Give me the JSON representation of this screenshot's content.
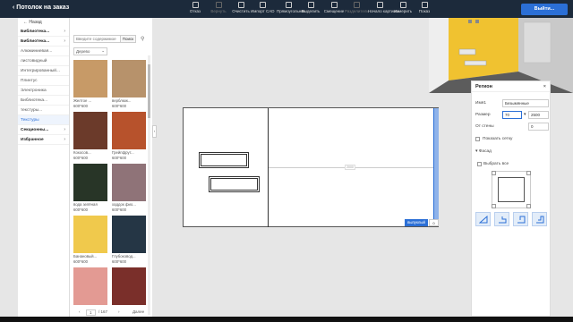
{
  "header": {
    "title": "Потолок на заказ",
    "tools": [
      {
        "label": "Отказ",
        "enabled": true
      },
      {
        "label": "Вернуть",
        "enabled": false
      },
      {
        "label": "Очистить",
        "enabled": true
      },
      {
        "label": "Импорт CAD",
        "enabled": true
      },
      {
        "label": "Прямоугольник",
        "enabled": true
      },
      {
        "label": "Выделить",
        "enabled": true
      },
      {
        "label": "Смещение",
        "enabled": true
      },
      {
        "label": "Разделитель",
        "enabled": false
      },
      {
        "label": "Начало картинки",
        "enabled": true
      },
      {
        "label": "Измерить",
        "enabled": true
      },
      {
        "label": "Показ",
        "enabled": true
      }
    ],
    "exit_label": "Выйти..."
  },
  "sidebar": {
    "back_label": "Назад",
    "items": [
      {
        "label": "Библиотека...",
        "bold": true,
        "chevron": "›"
      },
      {
        "label": "Библиотека...",
        "bold": true,
        "chevron": "›"
      },
      {
        "label": "Алюминиевая...",
        "bold": false,
        "chevron": ""
      },
      {
        "label": "листовидный",
        "bold": false,
        "chevron": ""
      },
      {
        "label": "Интегрированный...",
        "bold": false,
        "chevron": ""
      },
      {
        "label": "Плинтус",
        "bold": false,
        "chevron": ""
      },
      {
        "label": "Электроника",
        "bold": false,
        "chevron": ""
      },
      {
        "label": "Библиотека...",
        "bold": false,
        "chevron": ""
      },
      {
        "label": "текстуры...",
        "bold": false,
        "chevron": ""
      },
      {
        "label": "Текстуры",
        "bold": false,
        "chevron": "",
        "selected": true
      },
      {
        "label": "Секционны...",
        "bold": true,
        "chevron": "›"
      },
      {
        "label": "Избранное",
        "bold": true,
        "chevron": "›"
      }
    ]
  },
  "texture_panel": {
    "search_placeholder": "Введите содержимое",
    "search_button": "Поиск",
    "category_select": "Дерево",
    "swatches": [
      {
        "name": "Желтое ...",
        "size": "600*600",
        "color": "#c79a67"
      },
      {
        "name": "верблюж...",
        "size": "600*600",
        "color": "#b7926b"
      },
      {
        "name": "Кокосов...",
        "size": "600*600",
        "color": "#6b3a2a"
      },
      {
        "name": "Грейпфрут...",
        "size": "600*600",
        "color": "#b7522c"
      },
      {
        "name": "вода зелёная",
        "size": "600*600",
        "color": "#283527"
      },
      {
        "name": "хаддок фио...",
        "size": "600*600",
        "color": "#8f7378"
      },
      {
        "name": "Банановый...",
        "size": "600*600",
        "color": "#f0c94c"
      },
      {
        "name": "Глубоковод...",
        "size": "600*600",
        "color": "#253645"
      },
      {
        "name": "",
        "size": "",
        "color": "#e39a93"
      },
      {
        "name": "",
        "size": "",
        "color": "#7a2f2a"
      }
    ],
    "pager": {
      "prev": "‹",
      "page": "1",
      "total": "/ 167",
      "next": "›",
      "more": "Далее"
    }
  },
  "canvas": {
    "dimension_label": "2000",
    "apply_button": "выпуклый",
    "value": "0"
  },
  "props": {
    "title": "Регион",
    "close": "×",
    "name_label": "Имя1",
    "name_value": "Безымянные",
    "size_label": "Размер",
    "size_w": "70",
    "size_sep": "▾",
    "size_h": "2500",
    "wall_label": "От стены",
    "wall_value": "0",
    "show_grid": "Показать сетку",
    "faces_label": "Фасад",
    "select_all": "Выбрать все"
  }
}
